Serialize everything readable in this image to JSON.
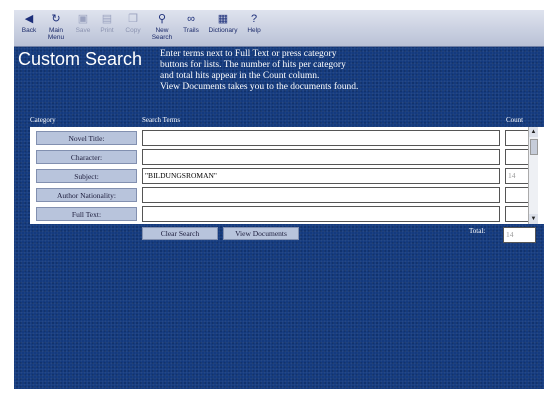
{
  "toolbar": {
    "items": [
      {
        "label": "Back",
        "icon": "back-arrow-icon",
        "glyph": "◀",
        "enabled": true
      },
      {
        "label": "Main Menu",
        "icon": "main-menu-icon",
        "glyph": "↻",
        "enabled": true
      },
      {
        "label": "Save",
        "icon": "save-icon",
        "glyph": "▣",
        "enabled": false
      },
      {
        "label": "Print",
        "icon": "print-icon",
        "glyph": "▤",
        "enabled": false
      },
      {
        "label": "Copy",
        "icon": "copy-icon",
        "glyph": "❐",
        "enabled": false
      },
      {
        "label": "New Search",
        "icon": "magnifier-icon",
        "glyph": "⚲",
        "enabled": true
      },
      {
        "label": "Trails",
        "icon": "trails-icon",
        "glyph": "∞",
        "enabled": true
      },
      {
        "label": "Dictionary",
        "icon": "dictionary-icon",
        "glyph": "▦",
        "enabled": true
      },
      {
        "label": "Help",
        "icon": "help-icon",
        "glyph": "?",
        "enabled": true
      }
    ]
  },
  "page": {
    "title": "Custom Search",
    "instructions": [
      "Enter terms next to Full Text or press category",
      "buttons for lists. The number of hits per category",
      "and total hits appear in the Count column.",
      "View Documents takes you to the documents found."
    ]
  },
  "table": {
    "headers": {
      "category": "Category",
      "terms": "Search Terms",
      "count": "Count"
    },
    "rows": [
      {
        "category": "Novel Title:",
        "term": "",
        "count": ""
      },
      {
        "category": "Character:",
        "term": "",
        "count": ""
      },
      {
        "category": "Subject:",
        "term": "\"BILDUNGSROMAN\"",
        "count": "14"
      },
      {
        "category": "Author Nationality:",
        "term": "",
        "count": ""
      },
      {
        "category": "Full Text:",
        "term": "",
        "count": ""
      }
    ]
  },
  "actions": {
    "clear": "Clear Search",
    "view": "View Documents",
    "total_label": "Total:",
    "total_value": "14"
  }
}
